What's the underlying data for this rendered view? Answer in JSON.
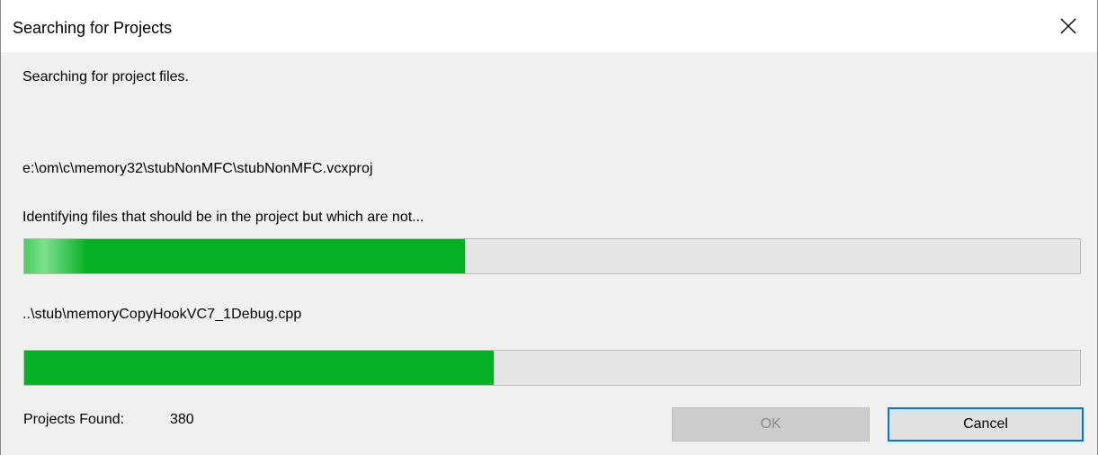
{
  "window": {
    "title": "Searching for Projects"
  },
  "status": {
    "heading": "Searching for project files.",
    "project_path": "e:\\om\\c\\memory32\\stubNonMFC\\stubNonMFC.vcxproj",
    "task": "Identifying files that should be in the project but which are not...",
    "current_file": "..\\stub\\memoryCopyHookVC7_1Debug.cpp"
  },
  "progress": {
    "overall_fraction": 0.417,
    "file_fraction": 0.445,
    "fill_color": "#06b025"
  },
  "footer": {
    "projects_found_label": "Projects Found:",
    "projects_found_count": "380",
    "ok_label": "OK",
    "cancel_label": "Cancel"
  },
  "icons": {
    "close": "close-icon"
  }
}
